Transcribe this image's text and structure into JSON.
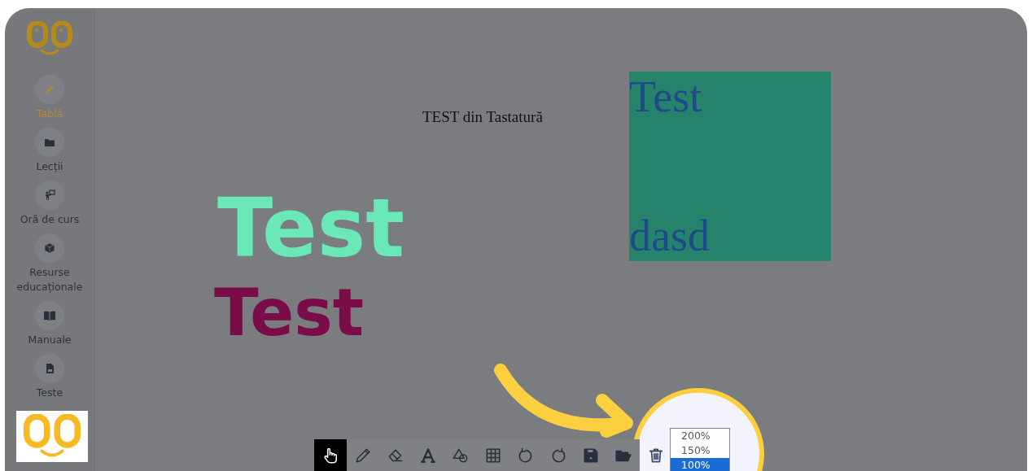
{
  "sidebar": {
    "items": [
      {
        "label": "Tablă",
        "kind": "pencil",
        "selected": true
      },
      {
        "label": "Lecții",
        "kind": "folder",
        "selected": false
      },
      {
        "label": "Oră de curs",
        "kind": "teacher",
        "selected": false
      },
      {
        "label": "Resurse educaționale",
        "kind": "cube",
        "selected": false
      },
      {
        "label": "Manuale",
        "kind": "book",
        "selected": false
      },
      {
        "label": "Teste",
        "kind": "file",
        "selected": false
      }
    ]
  },
  "canvas": {
    "typed_text": "TEST din Tastatură",
    "text_box": {
      "color": "#24836a",
      "lines": [
        "Test",
        "dasd"
      ]
    },
    "handwriting": [
      {
        "text": "Test",
        "color": "#6ae8b8"
      },
      {
        "text": "Test",
        "color": "#7a0c48"
      }
    ]
  },
  "toolbar": {
    "tools": [
      {
        "kind": "hand",
        "selected": true
      },
      {
        "kind": "pencil",
        "selected": false
      },
      {
        "kind": "eraser",
        "selected": false
      },
      {
        "kind": "text",
        "selected": false
      },
      {
        "kind": "shapes",
        "selected": false
      },
      {
        "kind": "grid",
        "selected": false
      },
      {
        "kind": "undo",
        "selected": false
      },
      {
        "kind": "redo",
        "selected": false
      },
      {
        "kind": "save",
        "selected": false
      },
      {
        "kind": "open",
        "selected": false
      },
      {
        "kind": "trash",
        "selected": false
      }
    ]
  },
  "zoom_menu": {
    "options": [
      {
        "label": "200%",
        "selected": false
      },
      {
        "label": "150%",
        "selected": false
      },
      {
        "label": "100%",
        "selected": true
      }
    ]
  }
}
